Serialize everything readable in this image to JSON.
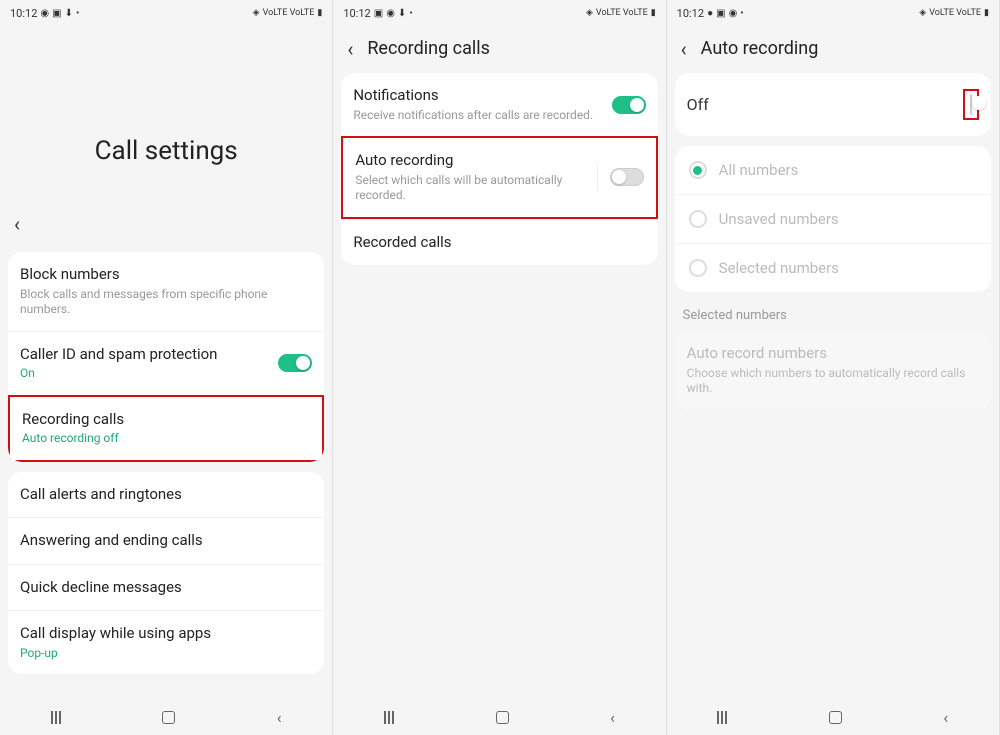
{
  "status": {
    "time": "10:12",
    "right": "VoLTE VoLTE"
  },
  "screen1": {
    "title": "Call settings",
    "items": [
      {
        "title": "Block numbers",
        "sub": "Block calls and messages from specific phone numbers."
      },
      {
        "title": "Caller ID and spam protection",
        "sub": "On"
      },
      {
        "title": "Recording calls",
        "sub": "Auto recording off"
      },
      {
        "title": "Call alerts and ringtones"
      },
      {
        "title": "Answering and ending calls"
      },
      {
        "title": "Quick decline messages"
      },
      {
        "title": "Call display while using apps",
        "sub": "Pop-up"
      }
    ]
  },
  "screen2": {
    "header": "Recording calls",
    "items": [
      {
        "title": "Notifications",
        "sub": "Receive notifications after calls are recorded."
      },
      {
        "title": "Auto recording",
        "sub": "Select which calls will be automatically recorded."
      },
      {
        "title": "Recorded calls"
      }
    ]
  },
  "screen3": {
    "header": "Auto recording",
    "off": "Off",
    "radios": [
      "All numbers",
      "Unsaved numbers",
      "Selected numbers"
    ],
    "section": "Selected numbers",
    "auto_title": "Auto record numbers",
    "auto_sub": "Choose which numbers to automatically record calls with."
  }
}
